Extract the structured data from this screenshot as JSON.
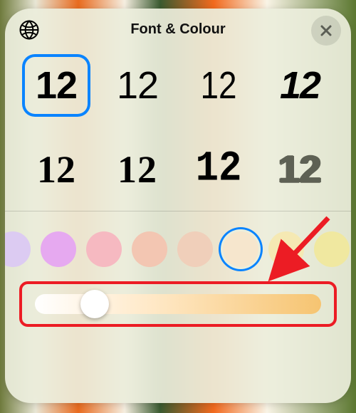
{
  "header": {
    "title": "Font & Colour"
  },
  "fonts": {
    "sample": "12",
    "selected_index": 0,
    "options": [
      "rounded",
      "default",
      "compact",
      "bold-italic",
      "serif",
      "slab",
      "mono",
      "outline"
    ]
  },
  "colors": {
    "selected_index": 5,
    "swatches": [
      "#dccbf2",
      "#e6a9f0",
      "#f6b9c1",
      "#f3c6b2",
      "#f0cfba",
      "#f6e6cd",
      "#f5e9b3"
    ]
  },
  "slider": {
    "value_percent": 22,
    "track_start": "#ffffff",
    "track_end": "#f6c471"
  },
  "annotation": {
    "highlight_slider_color": "#ec1c24",
    "arrow_color": "#ec1c24"
  }
}
